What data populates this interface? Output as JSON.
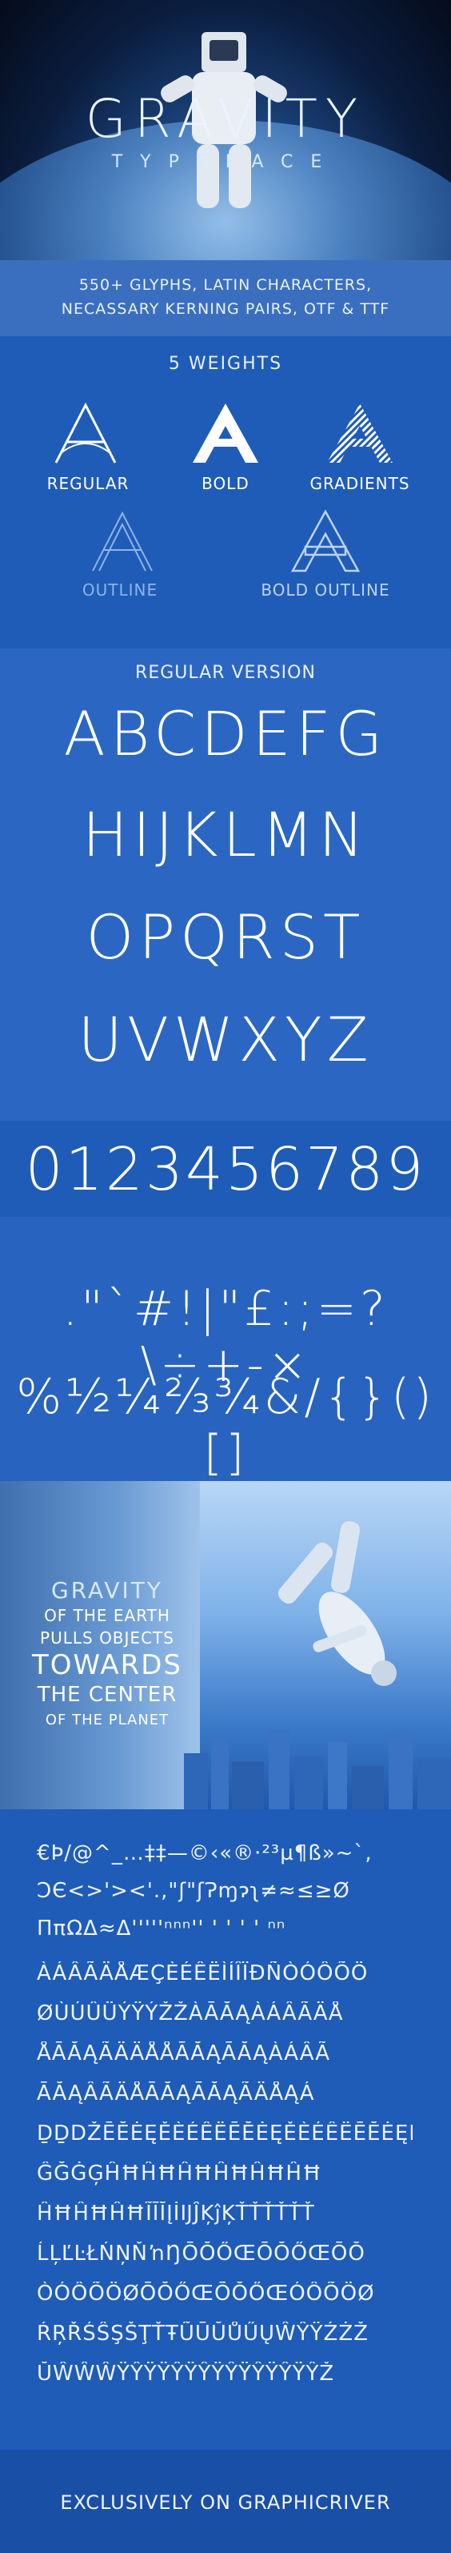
{
  "hero": {
    "title": "GRAVITY",
    "subtitle": "TYPEFACE"
  },
  "info": {
    "line1": "550+ GLYPHS, LATIN CHARACTERS,",
    "line2": "NECASSARY KERNING PAIRS, OTF & TTF"
  },
  "weights": {
    "heading": "5 WEIGHTS",
    "glyph": "A",
    "items": [
      {
        "label": "REGULAR",
        "color": "#ffffff"
      },
      {
        "label": "BOLD",
        "color": "#ffffff"
      },
      {
        "label": "GRADIENTS",
        "color": "#ffffff"
      },
      {
        "label": "OUTLINE",
        "color": "#8fb3e6"
      },
      {
        "label": "BOLD OUTLINE",
        "color": "#bcd2f0"
      }
    ]
  },
  "regular": {
    "heading": "REGULAR VERSION",
    "rows": [
      "ABCDEFG",
      "HIJKLMN",
      "OPQRST",
      "UVWXYZ"
    ]
  },
  "numbers": {
    "digits": "0123456789"
  },
  "punctuation": {
    "row1": ".\"`#!|\"£:;=?\\÷+-×",
    "row2": "%½¼⅔¾&/{}()[]"
  },
  "quote": {
    "line1": "GRAVITY",
    "line2": "OF THE EARTH",
    "line3": "PULLS OBJECTS",
    "line4": "TOWARDS",
    "line5": "THE CENTER",
    "line6": "OF THE PLANET"
  },
  "glyphs": {
    "rows": [
      "€Þ/@^_…‡‡—©‹«®·²³µ¶ß»~`,",
      "ƆЄ<>'><'.,\"ʃ\"ʃɁɱɂʅ≠≈≤≥Ø",
      "ΠπΩΔ≈Δ'''''ⁿⁿⁿ'' ' ' ' ' ⁿⁿ",
      "ÀÁÂÃÄÅÆÇÈÉÊËÌÍÎÏÐÑÒÓÔÕÖ",
      "ØÙÚÛÜÝŸÝŽŽÀĀĂĄÀÁÂÃÄÅ",
      "ÅĀĂĄÃÄÄÅÅĀĂĄĀĂĄÀÁÂÃ",
      "ĀĂĄÂÃÄÅĀĂĄĀĂĄÃÄÅĄÁ",
      "ḎḎDŽĒĔĖĘĚÈÉÊËĒĔĖĘĚÈÉÊËĒĔĖĘĚ",
      "ĜĞĠĢĤĦĤĦĤĦĤĦĤĦĤĦ",
      "ĤĦĤĦĤĦĨĪĬĮİĲĴĶĵĶŤŤŤŤŤŤ",
      "ĹĻĽĿŁŃŅŇŉŊŌŎŐŒŌŎŐŒŌŎ",
      "ÒÓÔÕÖØŌŎŐŒŌŎŐŒÓÔÕÖØ",
      "ŔŖŘŚŜŞŠŢŤŦŨŪŬŮŰŲŴŶŸŹŻŽ",
      "ŬŴŴŴŸŶŸŸŶŸŶŸŶŸŶŸŶŸŶŽ"
    ]
  },
  "footer": {
    "text": "EXCLUSIVELY ON GRAPHICRIVER"
  }
}
